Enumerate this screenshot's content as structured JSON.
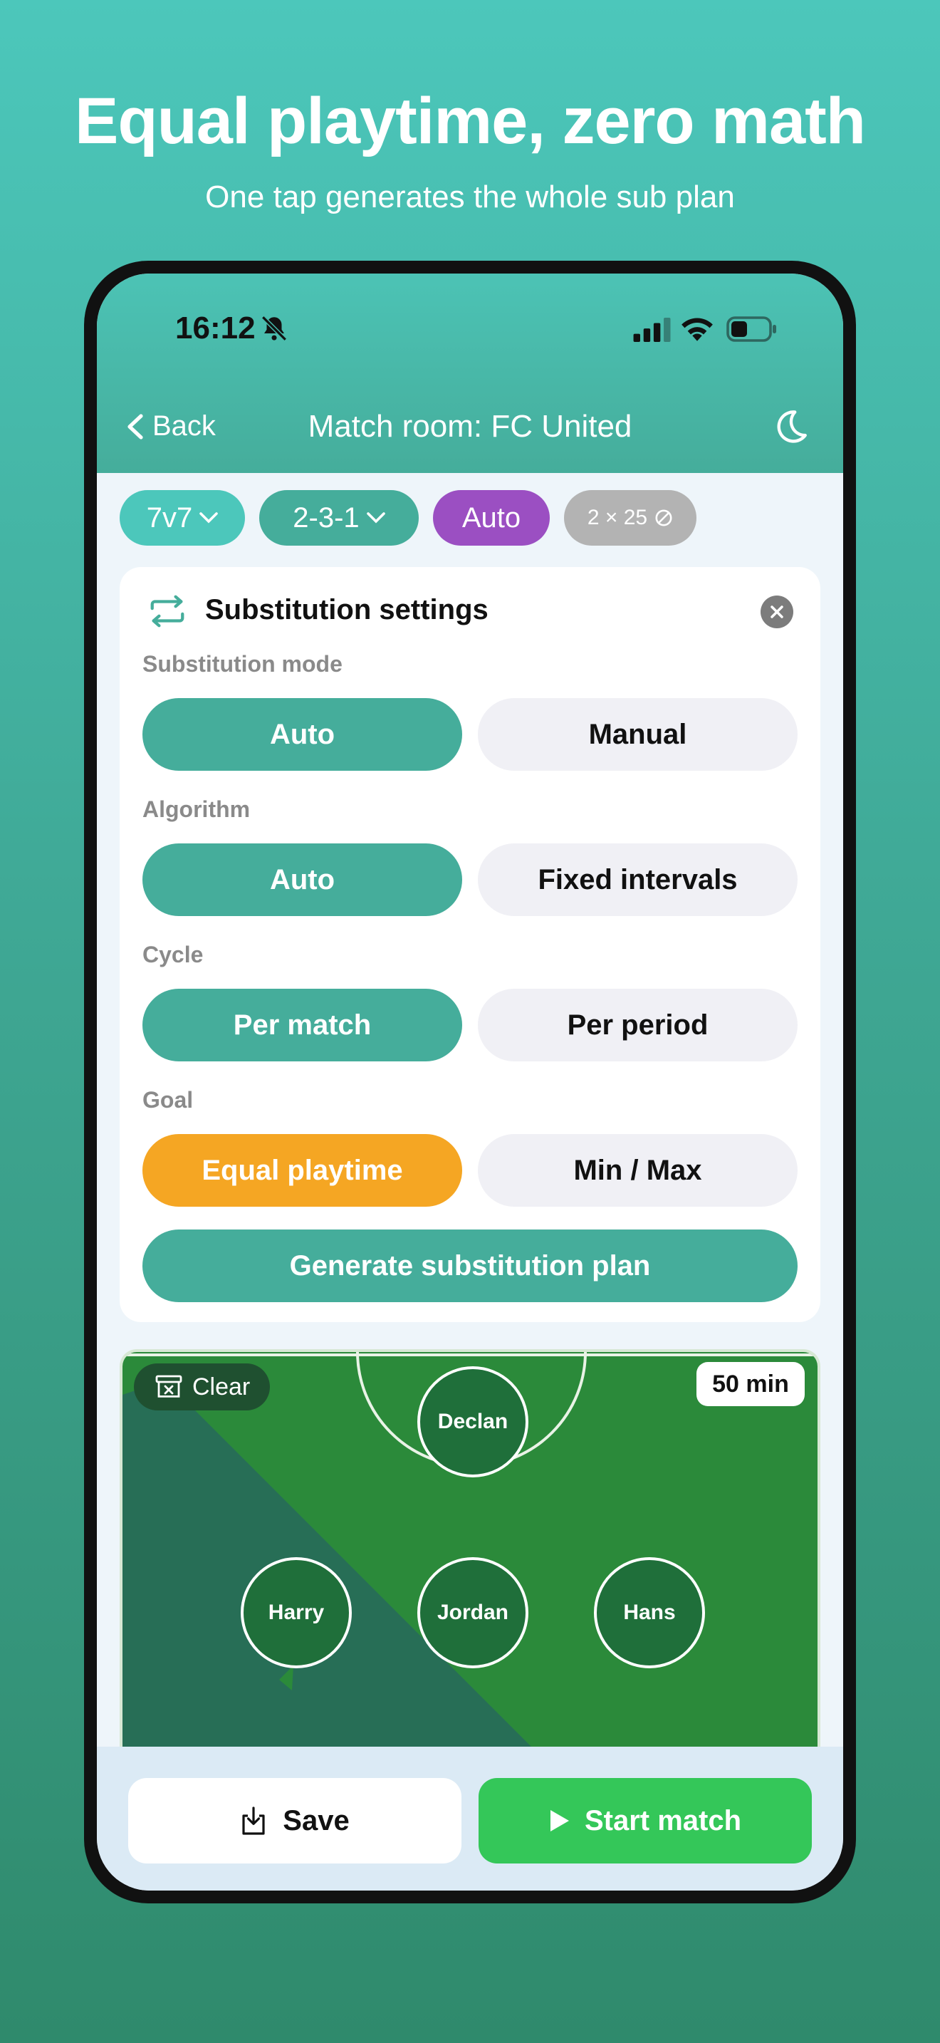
{
  "promo": {
    "headline": "Equal playtime, zero math",
    "subline": "One tap generates the whole sub plan"
  },
  "status_bar": {
    "time": "16:12"
  },
  "nav": {
    "back_label": "Back",
    "title": "Match room: FC United"
  },
  "chips": {
    "format": "7v7",
    "formation": "2-3-1",
    "mode": "Auto",
    "periods": "2 × 25"
  },
  "settings": {
    "title": "Substitution settings",
    "groups": [
      {
        "label": "Substitution mode",
        "options": [
          "Auto",
          "Manual"
        ],
        "selected": 0
      },
      {
        "label": "Algorithm",
        "options": [
          "Auto",
          "Fixed intervals"
        ],
        "selected": 0
      },
      {
        "label": "Cycle",
        "options": [
          "Per match",
          "Per period"
        ],
        "selected": 0
      },
      {
        "label": "Goal",
        "options": [
          "Equal playtime",
          "Min / Max"
        ],
        "selected": 0
      }
    ],
    "generate_label": "Generate substitution plan"
  },
  "field": {
    "clear_label": "Clear",
    "duration": "50 min",
    "players": [
      "Declan",
      "Harry",
      "Jordan",
      "Hans"
    ]
  },
  "actions": {
    "save_label": "Save",
    "start_label": "Start match"
  },
  "colors": {
    "teal": "#45ad9b",
    "purple": "#9b4fc2",
    "orange": "#f5a623",
    "green": "#34c759",
    "pitch": "#2b8a3a"
  }
}
